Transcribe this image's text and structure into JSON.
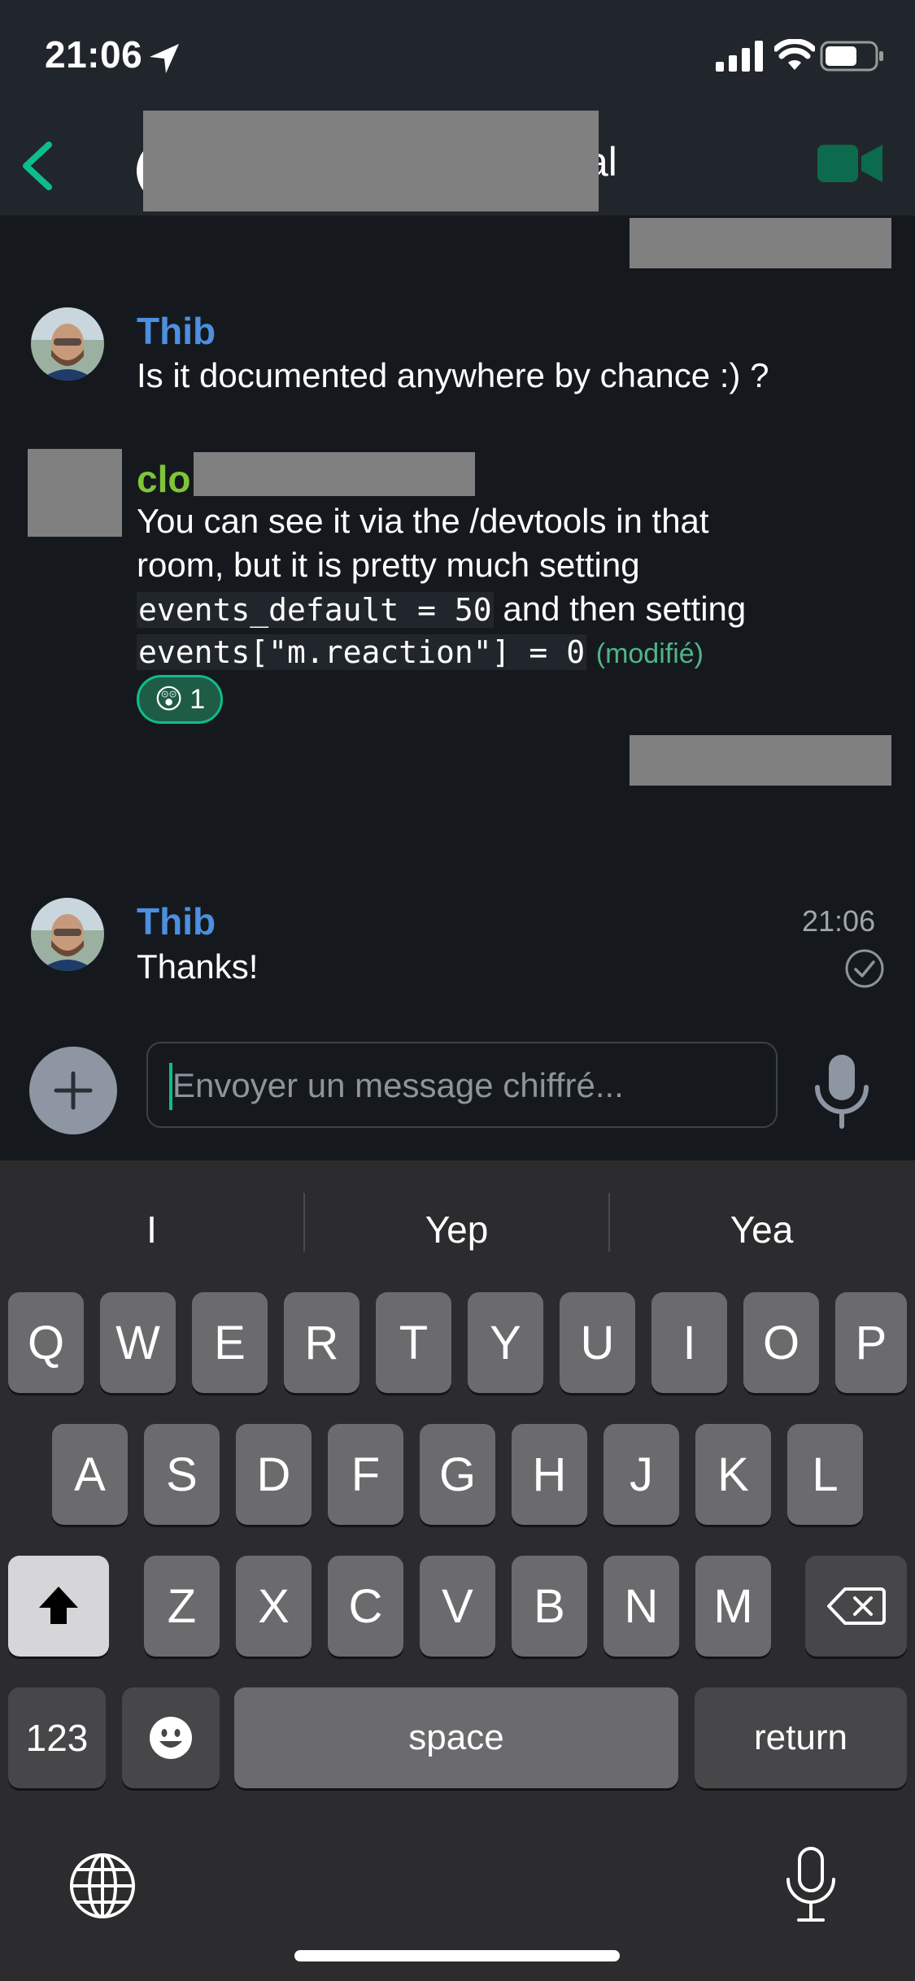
{
  "status_bar": {
    "time": "21:06"
  },
  "header": {
    "title_visible_fragment": "al"
  },
  "messages": [
    {
      "sender": "Thib",
      "text": "Is it documented anywhere by chance :) ?"
    },
    {
      "sender_visible_prefix": "clo",
      "line1": "You can see it via the /devtools in that",
      "line2": "room, but it is pretty much setting",
      "code1": "events_default = 50",
      "line3_rest": "and then setting",
      "code2": "events[\"m.reaction\"] = 0",
      "edited": "(modifié)",
      "reaction": {
        "emoji": "😲",
        "count": "1"
      }
    },
    {
      "sender": "Thib",
      "text": "Thanks!",
      "time": "21:06"
    }
  ],
  "composer": {
    "placeholder": "Envoyer un message chiffré..."
  },
  "keyboard": {
    "suggestions": [
      "I",
      "Yep",
      "Yea"
    ],
    "row1": [
      "Q",
      "W",
      "E",
      "R",
      "T",
      "Y",
      "U",
      "I",
      "O",
      "P"
    ],
    "row2": [
      "A",
      "S",
      "D",
      "F",
      "G",
      "H",
      "J",
      "K",
      "L"
    ],
    "row3": [
      "Z",
      "X",
      "C",
      "V",
      "B",
      "N",
      "M"
    ],
    "numbers_label": "123",
    "space_label": "space",
    "return_label": "return"
  },
  "colors": {
    "accent": "#0dbd8b",
    "sender_thib": "#4d8fe0",
    "sender_clo": "#7ec538"
  }
}
